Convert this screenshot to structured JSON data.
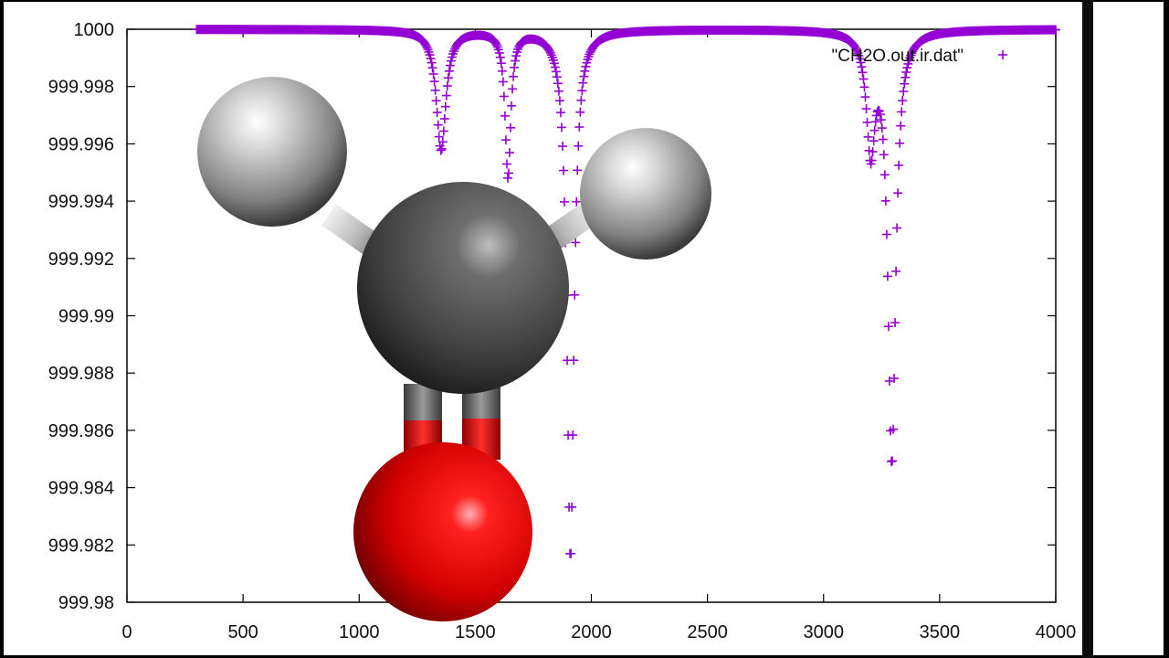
{
  "chart_data": {
    "type": "scatter",
    "title": "",
    "xlabel": "",
    "ylabel": "",
    "xlim": [
      0,
      4000
    ],
    "ylim": [
      999.98,
      1000
    ],
    "x_ticks": [
      "0",
      "500",
      "1000",
      "1500",
      "2000",
      "2500",
      "3000",
      "3500",
      "4000"
    ],
    "y_ticks": [
      "1000",
      "999.998",
      "999.996",
      "999.994",
      "999.992",
      "999.99",
      "999.988",
      "999.986",
      "999.984",
      "999.982",
      "999.98"
    ],
    "legend": {
      "entry": "\"CH2O.out.ir.dat\"",
      "position": "top-right"
    },
    "marker": "+",
    "color": "#9400d3",
    "baseline_y": 1000,
    "x_start": 300,
    "x_end": 4000,
    "bands": [
      {
        "center": 1353,
        "width": 25,
        "min": 999.9958
      },
      {
        "center": 1641,
        "width": 15,
        "min": 999.9949
      },
      {
        "center": 1910,
        "width": 18,
        "min": 999.9815
      },
      {
        "center": 3203,
        "width": 22,
        "min": 999.996
      },
      {
        "center": 3294,
        "width": 20,
        "min": 999.985
      }
    ],
    "molecule": {
      "name": "CH2O",
      "atoms": [
        "H",
        "H",
        "C",
        "O"
      ],
      "colors": {
        "hydrogen": "#e8e8e8",
        "carbon": "#555555",
        "oxygen": "#e00000"
      }
    }
  }
}
